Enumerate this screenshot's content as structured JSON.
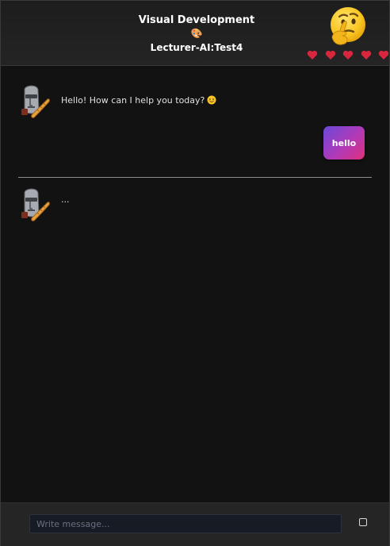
{
  "header": {
    "title": "Visual Development",
    "palette_emoji": "🎨",
    "subtitle": "Lecturer-AI:Test4",
    "status_emoji_icon": "thinking-face-icon",
    "hearts": [
      "heart-icon",
      "heart-icon",
      "heart-icon",
      "heart-icon",
      "heart-icon"
    ],
    "heart_color": "#d7263d"
  },
  "chat": {
    "messages": [
      {
        "role": "bot",
        "avatar_icon": "moai-baguette-avatar",
        "text": "Hello! How can I help you today?",
        "emoji_icon": "smiling-face-icon"
      },
      {
        "role": "user",
        "text": "hello",
        "bubble_gradient": [
          "#6a48d8",
          "#b13ab8",
          "#e0307a"
        ]
      },
      {
        "role": "bot",
        "avatar_icon": "moai-baguette-avatar",
        "text": "..."
      }
    ]
  },
  "composer": {
    "placeholder": "Write message...",
    "value": "",
    "send_icon": "square-icon"
  },
  "colors": {
    "background": "#121212",
    "header_bg": "#222222",
    "footer_bg": "#252525",
    "divider": "#8c8c8c"
  }
}
